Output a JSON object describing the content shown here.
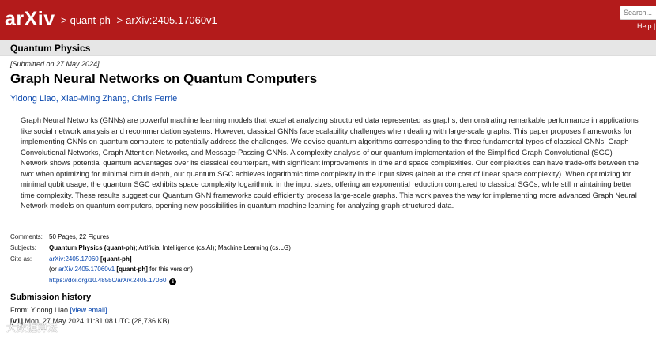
{
  "header": {
    "logo": "arXiv",
    "breadcrumb": [
      "quant-ph",
      "arXiv:2405.17060v1"
    ],
    "search_placeholder": "Search...",
    "help_links": "Help | A"
  },
  "subject_bar": "Quantum Physics",
  "paper": {
    "submitted": "[Submitted on 27 May 2024]",
    "title": "Graph Neural Networks on Quantum Computers",
    "authors": [
      "Yidong Liao",
      "Xiao-Ming Zhang",
      "Chris Ferrie"
    ],
    "abstract_lines": [
      "Graph Neural Networks (GNNs) are powerful machine learning models that excel at analyzing structured data represented as graphs, demonstrating remarkable performance in applications",
      "like social network analysis and recommendation systems. However, classical GNNs face scalability challenges when dealing with large-scale graphs. This paper proposes frameworks for",
      "implementing GNNs on quantum computers to potentially address the challenges. We devise quantum algorithms corresponding to the three fundamental types of classical GNNs: Graph",
      "Convolutional Networks, Graph Attention Networks, and Message-Passing GNNs. A complexity analysis of our quantum implementation of the Simplified Graph Convolutional (SGC)",
      "Network shows potential quantum advantages over its classical counterpart, with significant improvements in time and space complexities. Our complexities can have trade-offs between the",
      "two: when optimizing for minimal circuit depth, our quantum SGC achieves logarithmic time complexity in the input sizes (albeit at the cost of linear space complexity). When optimizing for",
      "minimal qubit usage, the quantum SGC exhibits space complexity logarithmic in the input sizes, offering an exponential reduction compared to classical SGCs, while still maintaining better",
      "time complexity. These results suggest our Quantum GNN frameworks could efficiently process large-scale graphs. This work paves the way for implementing more advanced Graph Neural",
      "Network models on quantum computers, opening new possibilities in quantum machine learning for analyzing graph-structured data."
    ]
  },
  "meta": {
    "comments_label": "Comments:",
    "comments": "50 Pages, 22 Figures",
    "subjects_label": "Subjects:",
    "subjects_primary": "Quantum Physics (quant-ph)",
    "subjects_rest": "; Artificial Intelligence (cs.AI); Machine Learning (cs.LG)",
    "cite_label": "Cite as:",
    "cite_id": "arXiv:2405.17060",
    "cite_tag": "[quant-ph]",
    "cite_or_prefix": "(or ",
    "cite_version_id": "arXiv:2405.17060v1",
    "cite_version_tag": "[quant-ph]",
    "cite_version_suffix": " for this version)",
    "doi": "https://doi.org/10.48550/arXiv.2405.17060"
  },
  "history": {
    "title": "Submission history",
    "from_prefix": "From: Yidong Liao ",
    "view_email": "[view email]",
    "v1_label": "[v1]",
    "v1_text": " Mon, 27 May 2024 11:31:08 UTC (28,736 KB)"
  },
  "watermark": "大数据算法"
}
